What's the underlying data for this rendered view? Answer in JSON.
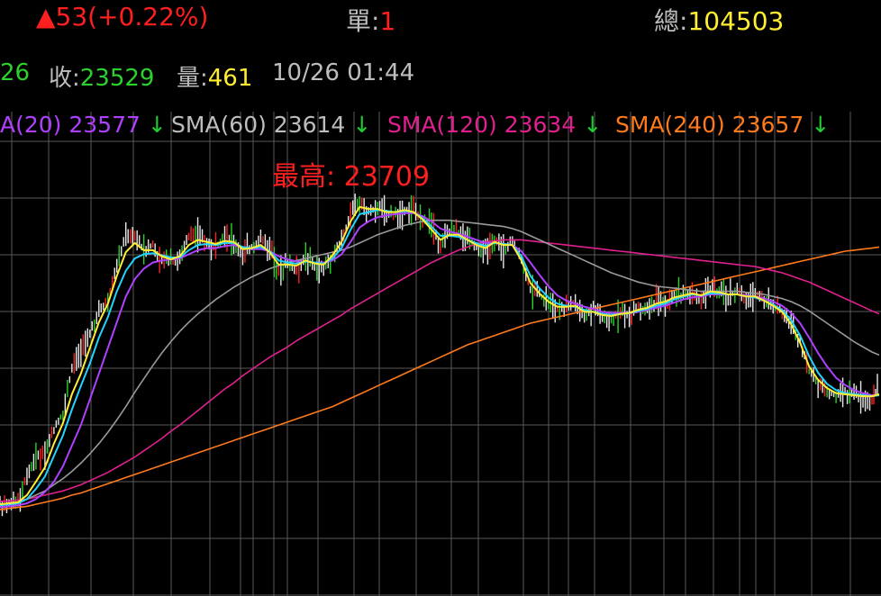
{
  "quote": {
    "change_arrow": "▲",
    "change": "53(+0.22%)",
    "single_label": "單:",
    "single_value": "1",
    "total_label": "總:",
    "total_value": "104503",
    "prev_tail": "26",
    "close_label": "收:",
    "close_value": "23529",
    "vol_label": "量:",
    "vol_value": "461",
    "timestamp": "10/26 01:44"
  },
  "sma_legend": [
    {
      "text": "A(20) 23577",
      "arrow": "↓",
      "color": "#b040ff"
    },
    {
      "text": "SMA(60) 23614",
      "arrow": "↓",
      "color": "#bdbdbd"
    },
    {
      "text": "SMA(120) 23634",
      "arrow": "↓",
      "color": "#e0208e"
    },
    {
      "text": "SMA(240) 23657",
      "arrow": "↓",
      "color": "#ff7a1a"
    }
  ],
  "high_label": "最高: 23709",
  "colors": {
    "up": "#ff1f1f",
    "down": "#2bd22b",
    "grid": "#5a5a5a",
    "sma5": "#ffee33",
    "sma10": "#22d4ff",
    "sma20": "#b040ff",
    "sma60": "#9a9a9a",
    "sma120": "#e0208e",
    "sma240": "#ff7a1a",
    "bar": "#e8e8e8"
  },
  "chart_data": {
    "type": "line",
    "ylim": [
      23380,
      23730
    ],
    "grid": true,
    "x": [
      0,
      10,
      20,
      30,
      40,
      50,
      60,
      70,
      80,
      90,
      100,
      110,
      120,
      130,
      140,
      150,
      160,
      170,
      180,
      190,
      200,
      210,
      220,
      230,
      240,
      250,
      260,
      270,
      280,
      290,
      300,
      310,
      320,
      330,
      340,
      350,
      360,
      370,
      380,
      390,
      400,
      410,
      420,
      430,
      440,
      450,
      460,
      470,
      480,
      490,
      500,
      510,
      520,
      530,
      540,
      550,
      560,
      570,
      580,
      590,
      600,
      610,
      620,
      630,
      640,
      650,
      660,
      670,
      680,
      690,
      700,
      710,
      720,
      730,
      740,
      750,
      760,
      770,
      780,
      790,
      800,
      810,
      820,
      830,
      840,
      850,
      860,
      870,
      880,
      890,
      900,
      910,
      920,
      930,
      940,
      950,
      960,
      970,
      978
    ],
    "price": [
      23393,
      23394,
      23397,
      23420,
      23439,
      23444,
      23466,
      23481,
      23525,
      23541,
      23559,
      23582,
      23590,
      23627,
      23655,
      23652,
      23639,
      23645,
      23629,
      23629,
      23632,
      23653,
      23656,
      23646,
      23643,
      23653,
      23649,
      23637,
      23643,
      23651,
      23639,
      23618,
      23627,
      23621,
      23634,
      23623,
      23622,
      23637,
      23650,
      23674,
      23686,
      23677,
      23682,
      23677,
      23674,
      23680,
      23680,
      23670,
      23665,
      23643,
      23659,
      23657,
      23651,
      23644,
      23638,
      23652,
      23641,
      23650,
      23631,
      23602,
      23597,
      23589,
      23582,
      23585,
      23588,
      23576,
      23585,
      23577,
      23575,
      23579,
      23577,
      23584,
      23583,
      23591,
      23588,
      23595,
      23597,
      23599,
      23593,
      23603,
      23598,
      23594,
      23601,
      23594,
      23598,
      23592,
      23585,
      23580,
      23570,
      23551,
      23522,
      23511,
      23503,
      23498,
      23501,
      23500,
      23495,
      23495,
      23505
    ],
    "series": {
      "sma5": [
        23393,
        23394,
        23395,
        23402,
        23415,
        23429,
        23452,
        23472,
        23500,
        23520,
        23545,
        23570,
        23588,
        23615,
        23638,
        23647,
        23640,
        23640,
        23634,
        23631,
        23634,
        23645,
        23650,
        23648,
        23646,
        23649,
        23648,
        23641,
        23642,
        23645,
        23638,
        23626,
        23626,
        23625,
        23630,
        23627,
        23626,
        23635,
        23648,
        23668,
        23682,
        23680,
        23680,
        23677,
        23677,
        23679,
        23677,
        23670,
        23660,
        23650,
        23655,
        23655,
        23650,
        23645,
        23642,
        23648,
        23645,
        23645,
        23630,
        23608,
        23598,
        23590,
        23585,
        23585,
        23586,
        23580,
        23580,
        23577,
        23576,
        23578,
        23579,
        23582,
        23584,
        23588,
        23590,
        23594,
        23596,
        23598,
        23596,
        23600,
        23599,
        23597,
        23597,
        23595,
        23595,
        23591,
        23586,
        23580,
        23568,
        23550,
        23527,
        23514,
        23506,
        23501,
        23500,
        23499,
        23498,
        23498,
        23500
      ],
      "sma10": [
        23392,
        23393,
        23394,
        23398,
        23408,
        23420,
        23440,
        23460,
        23485,
        23508,
        23530,
        23555,
        23575,
        23600,
        23620,
        23632,
        23636,
        23637,
        23635,
        23633,
        23633,
        23640,
        23645,
        23646,
        23645,
        23647,
        23647,
        23643,
        23642,
        23643,
        23639,
        23630,
        23628,
        23627,
        23629,
        23628,
        23627,
        23632,
        23642,
        23660,
        23675,
        23677,
        23679,
        23678,
        23677,
        23678,
        23677,
        23671,
        23663,
        23654,
        23654,
        23653,
        23650,
        23647,
        23644,
        23647,
        23646,
        23645,
        23634,
        23615,
        23603,
        23594,
        23588,
        23586,
        23585,
        23582,
        23580,
        23578,
        23577,
        23578,
        23579,
        23581,
        23583,
        23586,
        23588,
        23592,
        23595,
        23597,
        23596,
        23598,
        23598,
        23597,
        23597,
        23595,
        23594,
        23591,
        23587,
        23582,
        23572,
        23557,
        23537,
        23521,
        23510,
        23504,
        23501,
        23500,
        23499,
        23498,
        23499
      ],
      "sma20": [
        23390,
        23391,
        23392,
        23394,
        23398,
        23405,
        23415,
        23430,
        23450,
        23470,
        23495,
        23520,
        23545,
        23570,
        23595,
        23612,
        23622,
        23628,
        23630,
        23631,
        23632,
        23636,
        23640,
        23642,
        23642,
        23644,
        23645,
        23643,
        23641,
        23641,
        23639,
        23634,
        23631,
        23629,
        23629,
        23628,
        23628,
        23630,
        23636,
        23648,
        23662,
        23668,
        23672,
        23674,
        23675,
        23676,
        23676,
        23673,
        23668,
        23661,
        23658,
        23656,
        23653,
        23650,
        23647,
        23647,
        23646,
        23645,
        23639,
        23628,
        23616,
        23605,
        23596,
        23591,
        23588,
        23585,
        23583,
        23580,
        23579,
        23579,
        23579,
        23580,
        23582,
        23584,
        23586,
        23589,
        23592,
        23594,
        23595,
        23597,
        23597,
        23597,
        23597,
        23596,
        23595,
        23593,
        23590,
        23586,
        23579,
        23569,
        23555,
        23540,
        23527,
        23516,
        23509,
        23504,
        23501,
        23499,
        23499
      ],
      "sma60": [
        23392,
        23393,
        23395,
        23398,
        23402,
        23406,
        23412,
        23418,
        23425,
        23433,
        23442,
        23452,
        23463,
        23475,
        23488,
        23502,
        23515,
        23528,
        23540,
        23551,
        23561,
        23570,
        23578,
        23585,
        23592,
        23598,
        23604,
        23609,
        23614,
        23618,
        23622,
        23625,
        23628,
        23630,
        23632,
        23634,
        23636,
        23638,
        23640,
        23643,
        23647,
        23651,
        23655,
        23658,
        23661,
        23664,
        23666,
        23668,
        23669,
        23669,
        23669,
        23668,
        23667,
        23666,
        23665,
        23664,
        23663,
        23661,
        23658,
        23654,
        23650,
        23646,
        23642,
        23638,
        23634,
        23630,
        23626,
        23622,
        23618,
        23615,
        23612,
        23609,
        23607,
        23605,
        23604,
        23603,
        23602,
        23601,
        23600,
        23600,
        23600,
        23600,
        23600,
        23599,
        23598,
        23597,
        23595,
        23593,
        23590,
        23586,
        23581,
        23575,
        23569,
        23563,
        23557,
        23551,
        23546,
        23541,
        23538
      ],
      "sma120": [
        23396,
        23396,
        23397,
        23398,
        23400,
        23402,
        23404,
        23406,
        23409,
        23412,
        23416,
        23420,
        23424,
        23429,
        23434,
        23439,
        23445,
        23451,
        23457,
        23464,
        23470,
        23477,
        23484,
        23491,
        23498,
        23505,
        23511,
        23518,
        23524,
        23530,
        23536,
        23541,
        23546,
        23552,
        23557,
        23562,
        23567,
        23572,
        23577,
        23583,
        23588,
        23593,
        23598,
        23603,
        23608,
        23613,
        23618,
        23623,
        23628,
        23632,
        23636,
        23640,
        23643,
        23646,
        23648,
        23649,
        23650,
        23650,
        23650,
        23649,
        23648,
        23647,
        23646,
        23645,
        23644,
        23643,
        23642,
        23641,
        23640,
        23639,
        23638,
        23637,
        23636,
        23635,
        23634,
        23633,
        23632,
        23631,
        23630,
        23629,
        23628,
        23627,
        23626,
        23625,
        23624,
        23622,
        23620,
        23618,
        23615,
        23612,
        23609,
        23605,
        23601,
        23597,
        23593,
        23589,
        23585,
        23581,
        23578
      ],
      "sma240": [
        23388,
        23389,
        23390,
        23391,
        23393,
        23395,
        23397,
        23399,
        23402,
        23404,
        23407,
        23410,
        23413,
        23416,
        23419,
        23422,
        23425,
        23428,
        23431,
        23434,
        23437,
        23440,
        23443,
        23446,
        23449,
        23452,
        23455,
        23458,
        23461,
        23464,
        23467,
        23470,
        23473,
        23476,
        23479,
        23482,
        23485,
        23488,
        23492,
        23496,
        23500,
        23504,
        23508,
        23512,
        23516,
        23520,
        23524,
        23528,
        23532,
        23536,
        23540,
        23544,
        23548,
        23551,
        23554,
        23557,
        23560,
        23563,
        23566,
        23569,
        23571,
        23573,
        23575,
        23577,
        23579,
        23581,
        23583,
        23585,
        23587,
        23589,
        23591,
        23593,
        23595,
        23597,
        23599,
        23601,
        23603,
        23605,
        23607,
        23609,
        23611,
        23613,
        23615,
        23617,
        23619,
        23621,
        23623,
        23625,
        23627,
        23629,
        23631,
        23633,
        23635,
        23637,
        23639,
        23640,
        23641,
        23642,
        23643
      ]
    }
  }
}
